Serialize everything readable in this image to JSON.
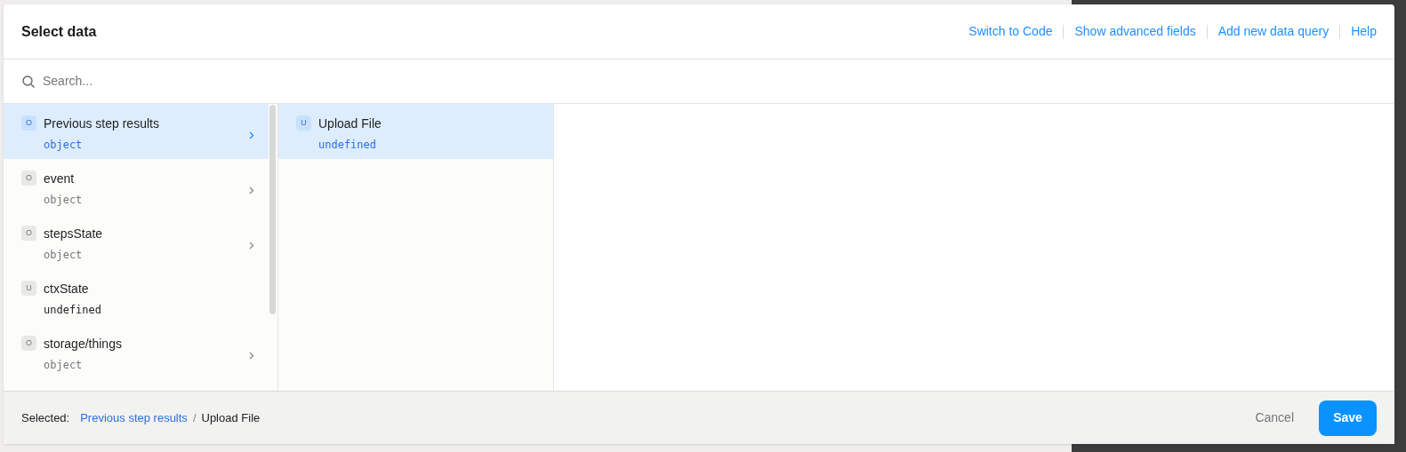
{
  "dialog": {
    "title": "Select data",
    "header_links": [
      "Switch to Code",
      "Show advanced fields",
      "Add new data query",
      "Help"
    ]
  },
  "search": {
    "placeholder": "Search..."
  },
  "columns": [
    {
      "items": [
        {
          "badge": "O",
          "label": "Previous step results",
          "type": "object",
          "selected": true,
          "expandable": true
        },
        {
          "badge": "O",
          "label": "event",
          "type": "object",
          "selected": false,
          "expandable": true
        },
        {
          "badge": "O",
          "label": "stepsState",
          "type": "object",
          "selected": false,
          "expandable": true
        },
        {
          "badge": "U",
          "label": "ctxState",
          "type": "undefined",
          "selected": false,
          "expandable": false
        },
        {
          "badge": "O",
          "label": "storage/things",
          "type": "object",
          "selected": false,
          "expandable": true
        }
      ]
    },
    {
      "items": [
        {
          "badge": "U",
          "label": "Upload File",
          "type": "undefined",
          "selected": true,
          "expandable": false
        }
      ]
    }
  ],
  "footer": {
    "selected_label": "Selected:",
    "path_link": "Previous step results",
    "separator": "/",
    "path_current": "Upload File",
    "cancel": "Cancel",
    "save": "Save"
  }
}
